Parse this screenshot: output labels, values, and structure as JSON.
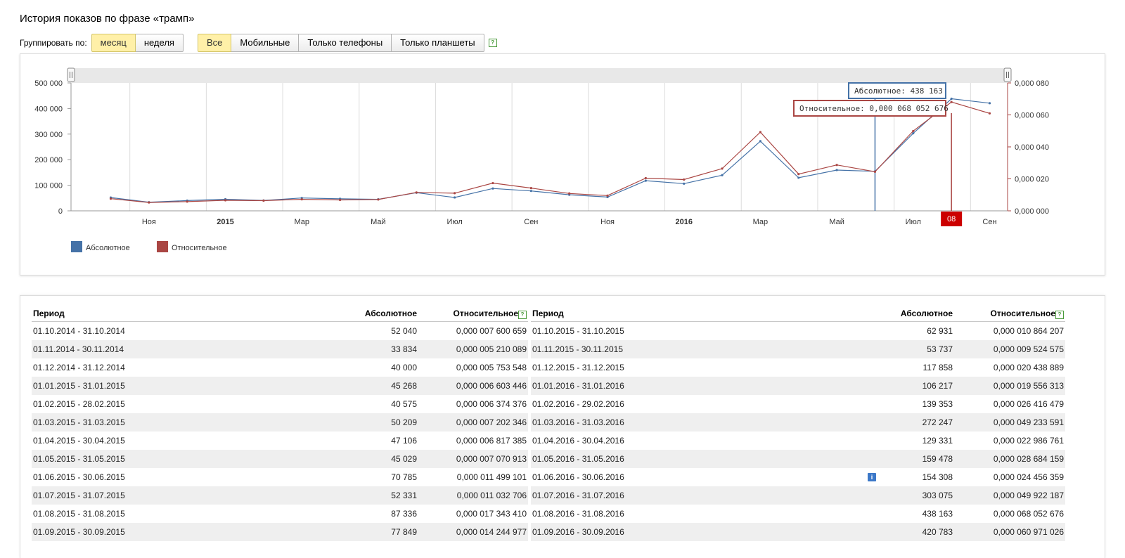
{
  "title": "История показов по фразе «трамп»",
  "group_label": "Группировать по:",
  "group_options": [
    "месяц",
    "неделя"
  ],
  "device_options": [
    "Все",
    "Мобильные",
    "Только телефоны",
    "Только планшеты"
  ],
  "help_glyph": "?",
  "colors": {
    "absolute": "#4572a7",
    "relative": "#aa4643",
    "active_button": "#fff0a8",
    "marker": "#cc0000"
  },
  "chart_data": {
    "type": "line",
    "x": [
      "2014-10",
      "2014-11",
      "2014-12",
      "2015-01",
      "2015-02",
      "2015-03",
      "2015-04",
      "2015-05",
      "2015-06",
      "2015-07",
      "2015-08",
      "2015-09",
      "2015-10",
      "2015-11",
      "2015-12",
      "2016-01",
      "2016-02",
      "2016-03",
      "2016-04",
      "2016-05",
      "2016-06",
      "2016-07",
      "2016-08",
      "2016-09"
    ],
    "series": [
      {
        "name": "Абсолютное",
        "axis": "left",
        "values": [
          52040,
          33834,
          40000,
          45268,
          40575,
          50209,
          47106,
          45029,
          70785,
          52331,
          87336,
          77849,
          62931,
          53737,
          117858,
          106217,
          139353,
          272247,
          129331,
          159478,
          154308,
          303075,
          438163,
          420783
        ]
      },
      {
        "name": "Относительное",
        "axis": "right",
        "values": [
          7.600659e-06,
          5.210089e-06,
          5.753548e-06,
          6.603446e-06,
          6.374376e-06,
          7.202346e-06,
          6.817385e-06,
          7.070913e-06,
          1.1499101e-05,
          1.1032706e-05,
          1.734341e-05,
          1.4244977e-05,
          1.0864207e-05,
          9.524575e-06,
          2.0438889e-05,
          1.9556313e-05,
          2.6416479e-05,
          4.9233591e-05,
          2.2986761e-05,
          2.8684159e-05,
          2.4456359e-05,
          4.9922187e-05,
          6.8052676e-05,
          6.0971026e-05
        ]
      }
    ],
    "x_tick_labels": [
      {
        "label": "Ноя",
        "x": "2014-11",
        "bold": false
      },
      {
        "label": "2015",
        "x": "2015-01",
        "bold": true
      },
      {
        "label": "Мар",
        "x": "2015-03",
        "bold": false
      },
      {
        "label": "Май",
        "x": "2015-05",
        "bold": false
      },
      {
        "label": "Июл",
        "x": "2015-07",
        "bold": false
      },
      {
        "label": "Сен",
        "x": "2015-09",
        "bold": false
      },
      {
        "label": "Ноя",
        "x": "2015-11",
        "bold": false
      },
      {
        "label": "2016",
        "x": "2016-01",
        "bold": true
      },
      {
        "label": "Мар",
        "x": "2016-03",
        "bold": false
      },
      {
        "label": "Май",
        "x": "2016-05",
        "bold": false
      },
      {
        "label": "Июл",
        "x": "2016-07",
        "bold": false
      },
      {
        "label": "Сен",
        "x": "2016-09",
        "bold": false
      }
    ],
    "y_left": {
      "ticks": [
        "0",
        "100 000",
        "200 000",
        "300 000",
        "400 000",
        "500 000"
      ],
      "range": [
        0,
        500000
      ]
    },
    "y_right": {
      "ticks": [
        "0,000 000",
        "0,000 020",
        "0,000 040",
        "0,000 060",
        "0,000 080"
      ],
      "range": [
        0,
        8e-05
      ]
    },
    "crosshair_absolute_x": "2016-06",
    "crosshair_relative_x": "2016-08",
    "marker_label": "08",
    "tooltip_absolute": "Абсолютное: 438 163",
    "tooltip_relative": "Относительное: 0,000 068 052 676",
    "legend": [
      "Абсолютное",
      "Относительное"
    ],
    "legend_position": "bottom-left",
    "grid": "vertical"
  },
  "table": {
    "headers": {
      "period": "Период",
      "absolute": "Абсолютное",
      "relative": "Относительное"
    },
    "left": [
      [
        "01.10.2014 - 31.10.2014",
        "52 040",
        "0,000 007 600 659"
      ],
      [
        "01.11.2014 - 30.11.2014",
        "33 834",
        "0,000 005 210 089"
      ],
      [
        "01.12.2014 - 31.12.2014",
        "40 000",
        "0,000 005 753 548"
      ],
      [
        "01.01.2015 - 31.01.2015",
        "45 268",
        "0,000 006 603 446"
      ],
      [
        "01.02.2015 - 28.02.2015",
        "40 575",
        "0,000 006 374 376"
      ],
      [
        "01.03.2015 - 31.03.2015",
        "50 209",
        "0,000 007 202 346"
      ],
      [
        "01.04.2015 - 30.04.2015",
        "47 106",
        "0,000 006 817 385"
      ],
      [
        "01.05.2015 - 31.05.2015",
        "45 029",
        "0,000 007 070 913"
      ],
      [
        "01.06.2015 - 30.06.2015",
        "70 785",
        "0,000 011 499 101"
      ],
      [
        "01.07.2015 - 31.07.2015",
        "52 331",
        "0,000 011 032 706"
      ],
      [
        "01.08.2015 - 31.08.2015",
        "87 336",
        "0,000 017 343 410"
      ],
      [
        "01.09.2015 - 30.09.2015",
        "77 849",
        "0,000 014 244 977"
      ]
    ],
    "right": [
      [
        "01.10.2015 - 31.10.2015",
        "62 931",
        "0,000 010 864 207"
      ],
      [
        "01.11.2015 - 30.11.2015",
        "53 737",
        "0,000 009 524 575"
      ],
      [
        "01.12.2015 - 31.12.2015",
        "117 858",
        "0,000 020 438 889"
      ],
      [
        "01.01.2016 - 31.01.2016",
        "106 217",
        "0,000 019 556 313"
      ],
      [
        "01.02.2016 - 29.02.2016",
        "139 353",
        "0,000 026 416 479"
      ],
      [
        "01.03.2016 - 31.03.2016",
        "272 247",
        "0,000 049 233 591"
      ],
      [
        "01.04.2016 - 30.04.2016",
        "129 331",
        "0,000 022 986 761"
      ],
      [
        "01.05.2016 - 31.05.2016",
        "159 478",
        "0,000 028 684 159"
      ],
      [
        "01.06.2016 - 30.06.2016",
        "154 308",
        "0,000 024 456 359"
      ],
      [
        "01.07.2016 - 31.07.2016",
        "303 075",
        "0,000 049 922 187"
      ],
      [
        "01.08.2016 - 31.08.2016",
        "438 163",
        "0,000 068 052 676"
      ],
      [
        "01.09.2016 - 30.09.2016",
        "420 783",
        "0,000 060 971 026"
      ]
    ],
    "info_row_index": 8,
    "info_icon": "info-icon",
    "info_glyph": "i"
  }
}
